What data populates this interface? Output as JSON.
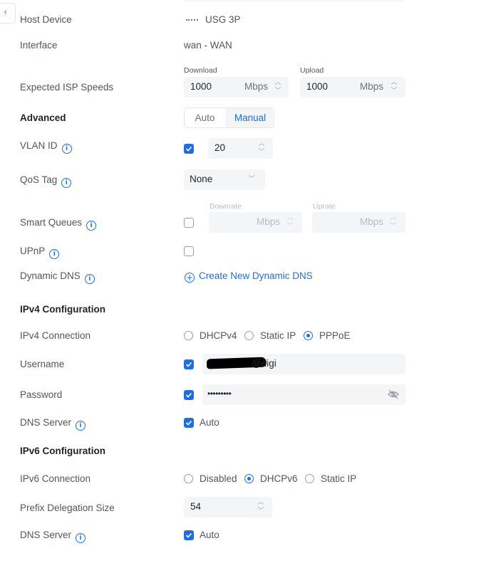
{
  "back_button": {
    "icon": "chevron-left-icon"
  },
  "rows": {
    "host_device": {
      "label": "Host Device",
      "value": "USG 3P",
      "icon": "device-icon"
    },
    "interface": {
      "label": "Interface",
      "value": "wan - WAN"
    },
    "isp_speeds": {
      "label": "Expected ISP Speeds",
      "download_label": "Download",
      "download_value": "1000",
      "download_unit": "Mbps",
      "upload_label": "Upload",
      "upload_value": "1000",
      "upload_unit": "Mbps"
    },
    "advanced": {
      "label": "Advanced",
      "options": [
        "Auto",
        "Manual"
      ],
      "selected": "Manual"
    },
    "vlan_id": {
      "label": "VLAN ID",
      "checked": true,
      "value": "20"
    },
    "qos_tag": {
      "label": "QoS Tag",
      "value": "None"
    },
    "smart_queues": {
      "label": "Smart Queues",
      "checked": false,
      "downrate_label": "Downrate",
      "downrate_unit": "Mbps",
      "uprate_label": "Uprate",
      "uprate_unit": "Mbps"
    },
    "upnp": {
      "label": "UPnP",
      "checked": false
    },
    "dynamic_dns": {
      "label": "Dynamic DNS",
      "action": "Create New Dynamic DNS"
    }
  },
  "ipv4": {
    "heading": "IPv4 Configuration",
    "connection": {
      "label": "IPv4 Connection",
      "options": [
        "DHCPv4",
        "Static IP",
        "PPPoE"
      ],
      "selected": "PPPoE"
    },
    "username": {
      "label": "Username",
      "checked": true,
      "value": "@digi"
    },
    "password": {
      "label": "Password",
      "checked": true,
      "value": "•••••••••"
    },
    "dns_server": {
      "label": "DNS Server",
      "checked": true,
      "value": "Auto"
    }
  },
  "ipv6": {
    "heading": "IPv6 Configuration",
    "connection": {
      "label": "IPv6 Connection",
      "options": [
        "Disabled",
        "DHCPv6",
        "Static IP"
      ],
      "selected": "DHCPv6"
    },
    "prefix": {
      "label": "Prefix Delegation Size",
      "value": "54"
    },
    "dns_server": {
      "label": "DNS Server",
      "checked": true,
      "value": "Auto"
    }
  },
  "colors": {
    "accent": "#1d6fde",
    "field_bg": "#f4f5f6",
    "label": "#50565e",
    "heading": "#1f2328"
  }
}
